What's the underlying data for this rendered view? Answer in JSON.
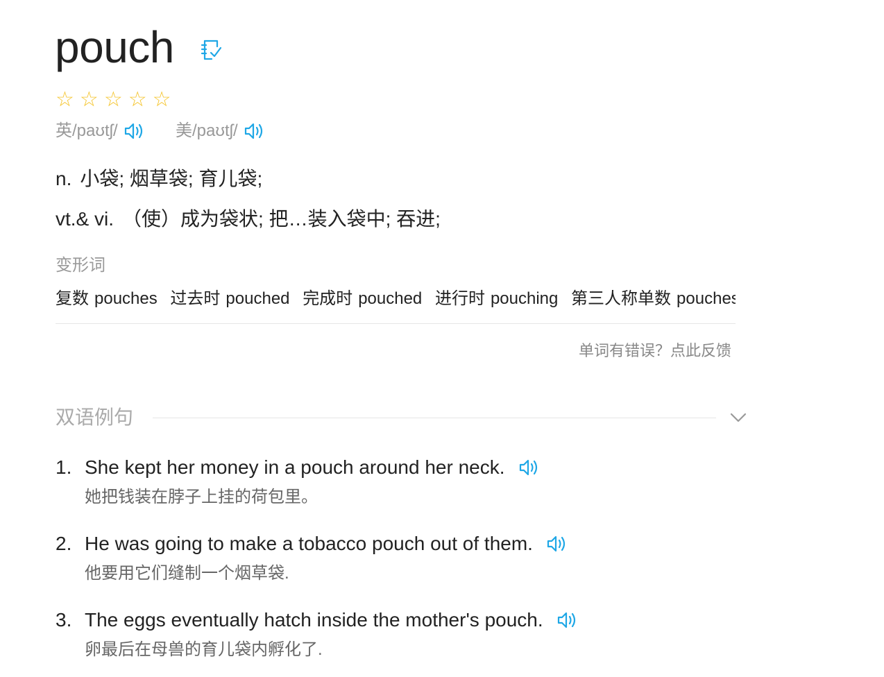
{
  "word": "pouch",
  "stars": [
    "☆",
    "☆",
    "☆",
    "☆",
    "☆"
  ],
  "phonetics": {
    "uk": "英/paʊtʃ/",
    "us": "美/paʊtʃ/"
  },
  "definitions": [
    {
      "pos": "n.",
      "meaning": "小袋; 烟草袋; 育儿袋;"
    },
    {
      "pos": "vt.& vi.",
      "meaning": "（使）成为袋状; 把…装入袋中; 吞进;"
    }
  ],
  "forms_title": "变形词",
  "forms": [
    {
      "label": "复数",
      "value": "pouches"
    },
    {
      "label": "过去时",
      "value": "pouched"
    },
    {
      "label": "完成时",
      "value": "pouched"
    },
    {
      "label": "进行时",
      "value": "pouching"
    },
    {
      "label": "第三人称单数",
      "value": "pouches"
    }
  ],
  "feedback": "单词有错误？点此反馈",
  "examples_title": "双语例句",
  "examples": [
    {
      "num": "1.",
      "en": "She kept her money in a pouch around her neck.",
      "zh": "她把钱装在脖子上挂的荷包里。"
    },
    {
      "num": "2.",
      "en": "He was going to make a tobacco pouch out of them.",
      "zh": "他要用它们缝制一个烟草袋."
    },
    {
      "num": "3.",
      "en": "The eggs eventually hatch inside the mother's pouch.",
      "zh": "卵最后在母兽的育儿袋内孵化了."
    }
  ],
  "colors": {
    "accent": "#1ea7e6",
    "star": "#f5c52e",
    "muted": "#999999"
  }
}
